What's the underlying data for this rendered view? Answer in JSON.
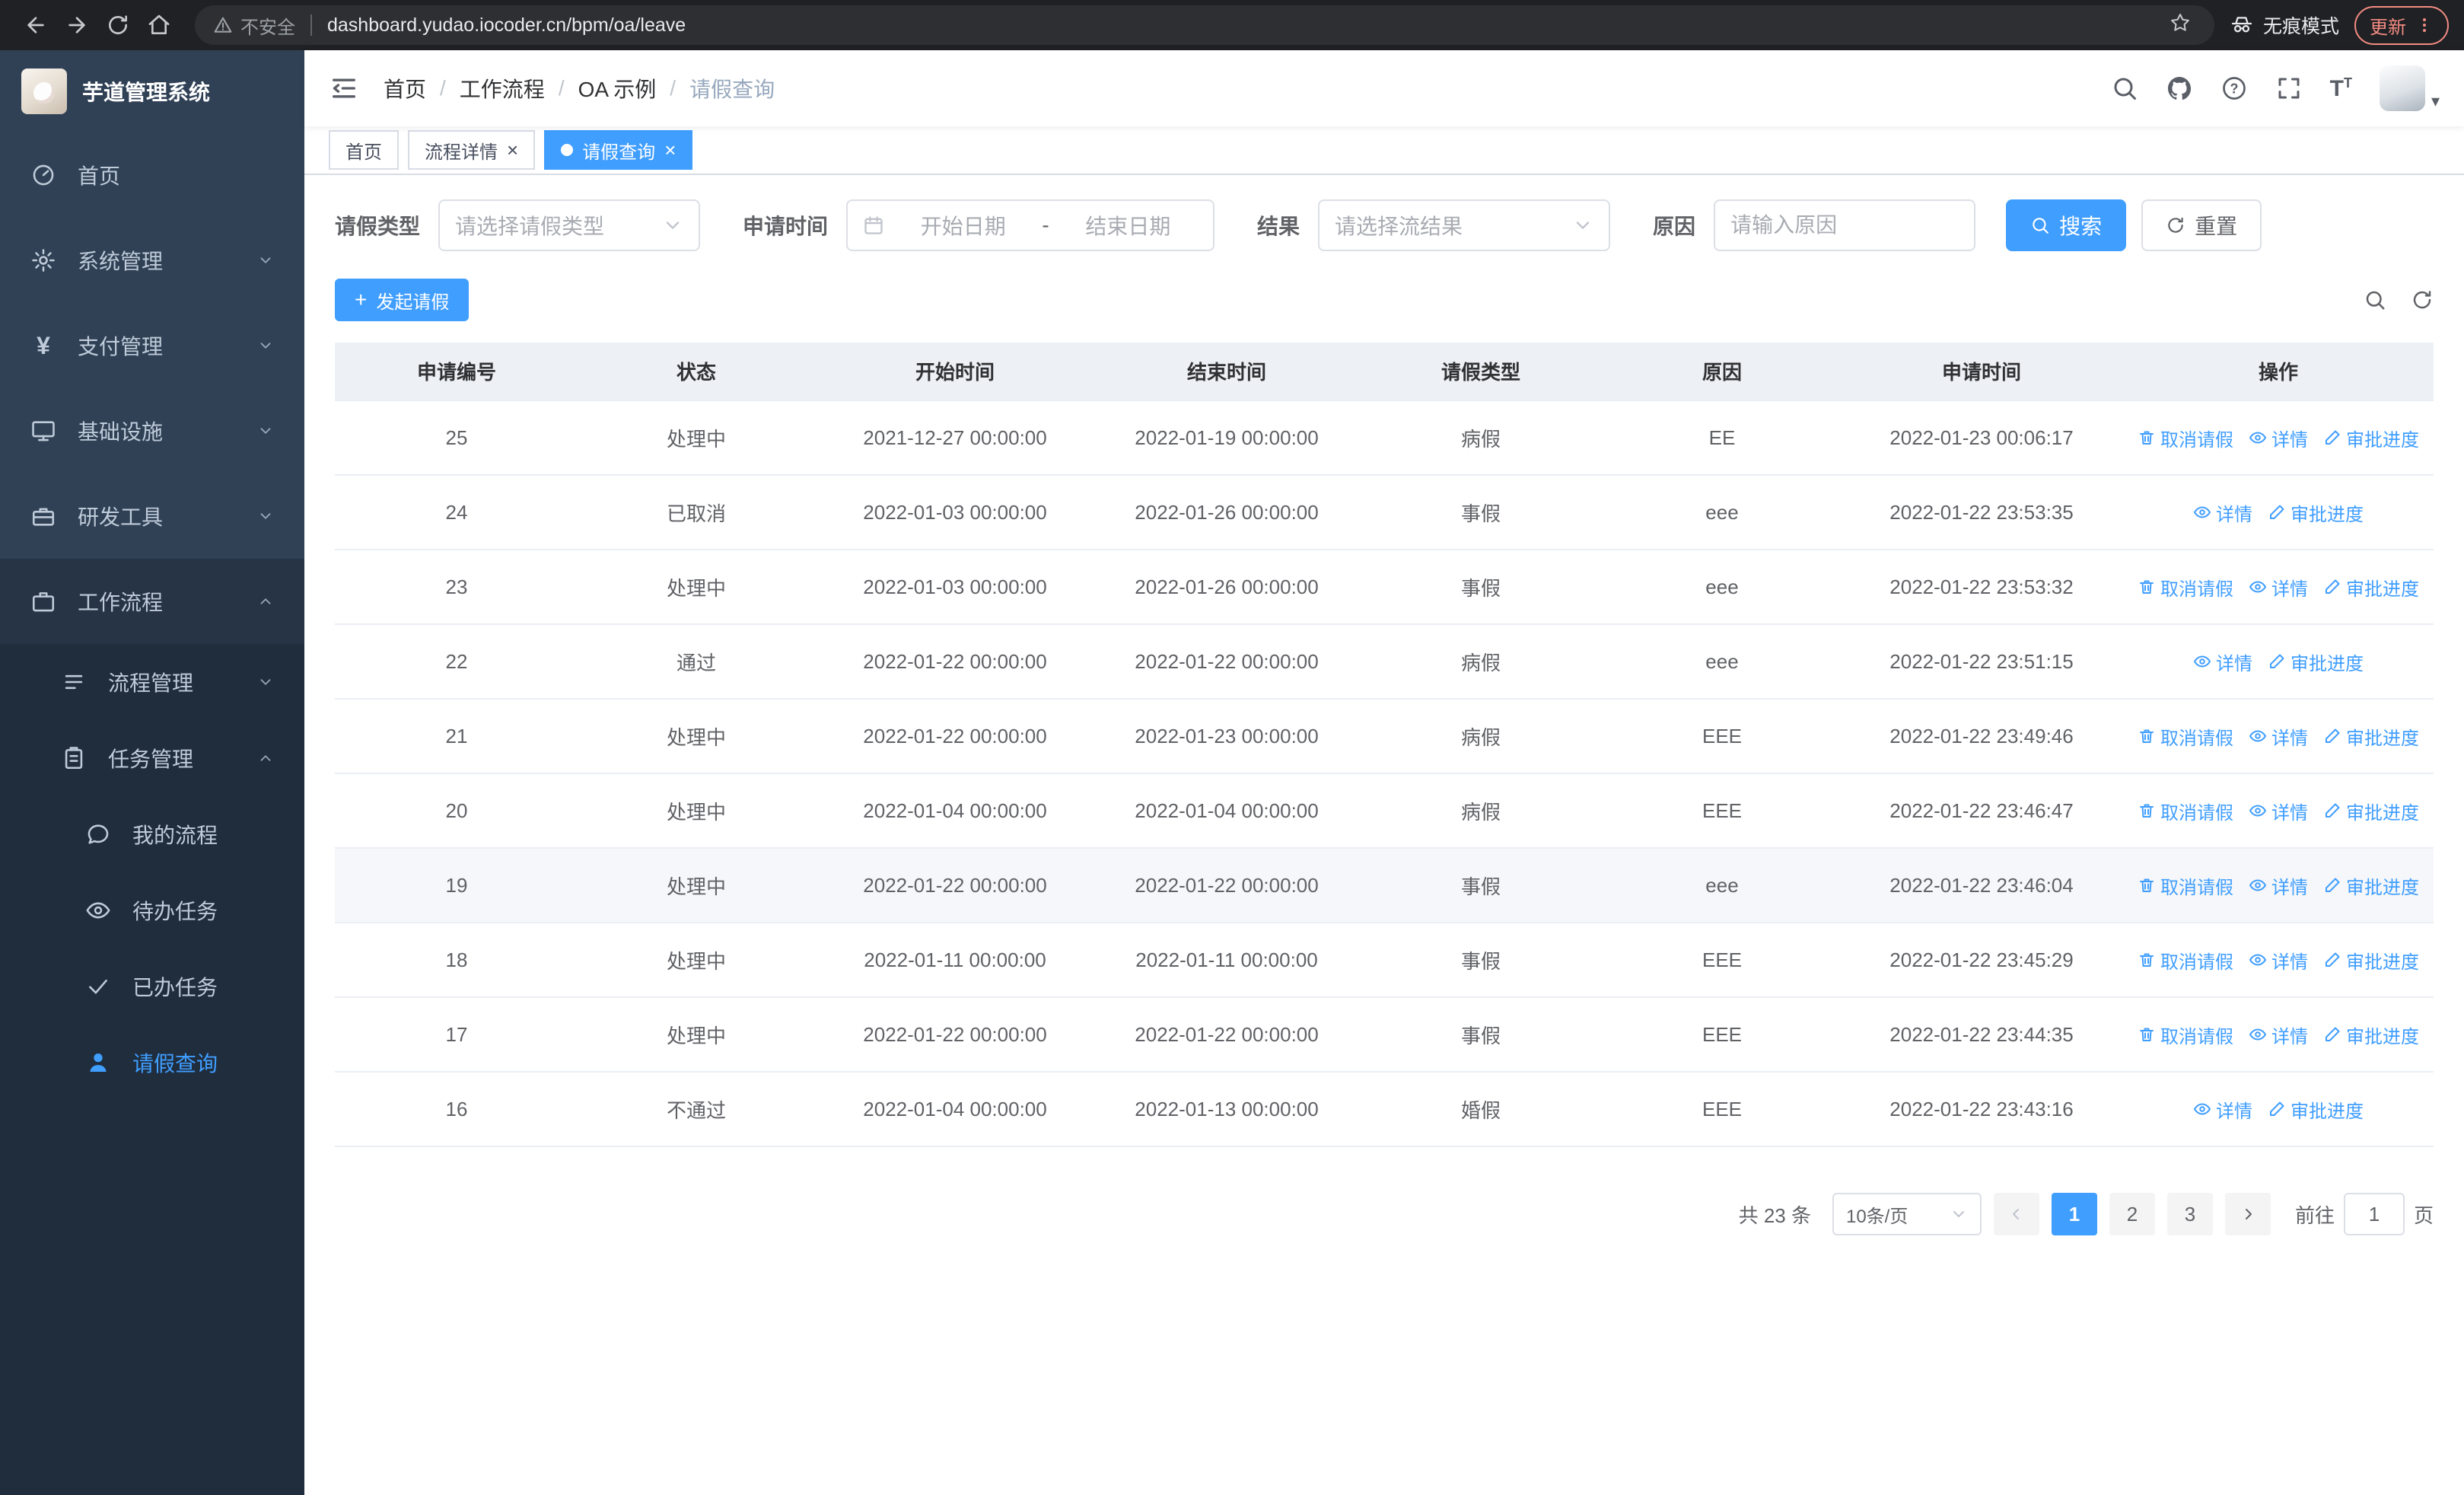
{
  "browser": {
    "security_label": "不安全",
    "url": "dashboard.yudao.iocoder.cn/bpm/oa/leave",
    "incognito_label": "无痕模式",
    "update_label": "更新"
  },
  "sidebar": {
    "logo_title": "芋道管理系统",
    "items": [
      {
        "label": "首页",
        "icon": "dashboard-icon"
      },
      {
        "label": "系统管理",
        "icon": "gear-icon"
      },
      {
        "label": "支付管理",
        "icon": "yen-icon"
      },
      {
        "label": "基础设施",
        "icon": "monitor-icon"
      },
      {
        "label": "研发工具",
        "icon": "toolbox-icon"
      },
      {
        "label": "工作流程",
        "icon": "briefcase-icon",
        "expanded": true
      }
    ],
    "sub_items": [
      {
        "label": "流程管理",
        "icon": "list-icon"
      },
      {
        "label": "任务管理",
        "icon": "clipboard-icon",
        "expanded": true
      }
    ],
    "leaf_items": [
      {
        "label": "我的流程",
        "icon": "chat-icon"
      },
      {
        "label": "待办任务",
        "icon": "eye-icon"
      },
      {
        "label": "已办任务",
        "icon": "check-icon"
      },
      {
        "label": "请假查询",
        "icon": "user-icon",
        "active": true
      }
    ]
  },
  "header": {
    "breadcrumb": [
      "首页",
      "工作流程",
      "OA 示例",
      "请假查询"
    ],
    "icons": [
      "search-icon",
      "github-icon",
      "question-icon",
      "fullscreen-icon",
      "font-size-icon"
    ]
  },
  "tabs": [
    {
      "label": "首页"
    },
    {
      "label": "流程详情",
      "closable": true
    },
    {
      "label": "请假查询",
      "closable": true,
      "active": true
    }
  ],
  "filters": {
    "leave_type_label": "请假类型",
    "leave_type_placeholder": "请选择请假类型",
    "apply_time_label": "申请时间",
    "start_date_placeholder": "开始日期",
    "range_separator": "-",
    "end_date_placeholder": "结束日期",
    "result_label": "结果",
    "result_placeholder": "请选择流结果",
    "reason_label": "原因",
    "reason_placeholder": "请输入原因",
    "search_button": "搜索",
    "reset_button": "重置"
  },
  "toolbar": {
    "create_button": "发起请假",
    "right_icons": [
      "search-icon",
      "refresh-icon"
    ]
  },
  "table": {
    "columns": [
      "申请编号",
      "状态",
      "开始时间",
      "结束时间",
      "请假类型",
      "原因",
      "申请时间",
      "操作"
    ],
    "action_labels": {
      "cancel": "取消请假",
      "detail": "详情",
      "progress": "审批进度"
    },
    "action_icons": {
      "cancel": "delete-icon",
      "detail": "view-icon",
      "progress": "edit-icon"
    },
    "rows": [
      {
        "id": "25",
        "status": "处理中",
        "start": "2021-12-27 00:00:00",
        "end": "2022-01-19 00:00:00",
        "type": "病假",
        "reason": "EE",
        "apply_time": "2022-01-23 00:06:17",
        "actions": [
          "cancel",
          "detail",
          "progress"
        ]
      },
      {
        "id": "24",
        "status": "已取消",
        "start": "2022-01-03 00:00:00",
        "end": "2022-01-26 00:00:00",
        "type": "事假",
        "reason": "eee",
        "apply_time": "2022-01-22 23:53:35",
        "actions": [
          "detail",
          "progress"
        ]
      },
      {
        "id": "23",
        "status": "处理中",
        "start": "2022-01-03 00:00:00",
        "end": "2022-01-26 00:00:00",
        "type": "事假",
        "reason": "eee",
        "apply_time": "2022-01-22 23:53:32",
        "actions": [
          "cancel",
          "detail",
          "progress"
        ]
      },
      {
        "id": "22",
        "status": "通过",
        "start": "2022-01-22 00:00:00",
        "end": "2022-01-22 00:00:00",
        "type": "病假",
        "reason": "eee",
        "apply_time": "2022-01-22 23:51:15",
        "actions": [
          "detail",
          "progress"
        ]
      },
      {
        "id": "21",
        "status": "处理中",
        "start": "2022-01-22 00:00:00",
        "end": "2022-01-23 00:00:00",
        "type": "病假",
        "reason": "EEE",
        "apply_time": "2022-01-22 23:49:46",
        "actions": [
          "cancel",
          "detail",
          "progress"
        ]
      },
      {
        "id": "20",
        "status": "处理中",
        "start": "2022-01-04 00:00:00",
        "end": "2022-01-04 00:00:00",
        "type": "病假",
        "reason": "EEE",
        "apply_time": "2022-01-22 23:46:47",
        "actions": [
          "cancel",
          "detail",
          "progress"
        ]
      },
      {
        "id": "19",
        "status": "处理中",
        "start": "2022-01-22 00:00:00",
        "end": "2022-01-22 00:00:00",
        "type": "事假",
        "reason": "eee",
        "apply_time": "2022-01-22 23:46:04",
        "actions": [
          "cancel",
          "detail",
          "progress"
        ],
        "highlighted": true
      },
      {
        "id": "18",
        "status": "处理中",
        "start": "2022-01-11 00:00:00",
        "end": "2022-01-11 00:00:00",
        "type": "事假",
        "reason": "EEE",
        "apply_time": "2022-01-22 23:45:29",
        "actions": [
          "cancel",
          "detail",
          "progress"
        ]
      },
      {
        "id": "17",
        "status": "处理中",
        "start": "2022-01-22 00:00:00",
        "end": "2022-01-22 00:00:00",
        "type": "事假",
        "reason": "EEE",
        "apply_time": "2022-01-22 23:44:35",
        "actions": [
          "cancel",
          "detail",
          "progress"
        ]
      },
      {
        "id": "16",
        "status": "不通过",
        "start": "2022-01-04 00:00:00",
        "end": "2022-01-13 00:00:00",
        "type": "婚假",
        "reason": "EEE",
        "apply_time": "2022-01-22 23:43:16",
        "actions": [
          "detail",
          "progress"
        ]
      }
    ]
  },
  "pagination": {
    "total": "共 23 条",
    "page_size": "10条/页",
    "pages": [
      {
        "label": "1",
        "active": true
      },
      {
        "label": "2"
      },
      {
        "label": "3"
      }
    ],
    "goto_label": "前往",
    "goto_value": "1",
    "page_label": "页"
  },
  "colors": {
    "primary": "#409EFF",
    "sidebar_bg": "#304156",
    "sidebar_submenu_bg": "#1f2d3d",
    "browser_bar_bg": "#202124",
    "table_header_bg": "#edf0f5",
    "update_accent": "#f28b82"
  }
}
